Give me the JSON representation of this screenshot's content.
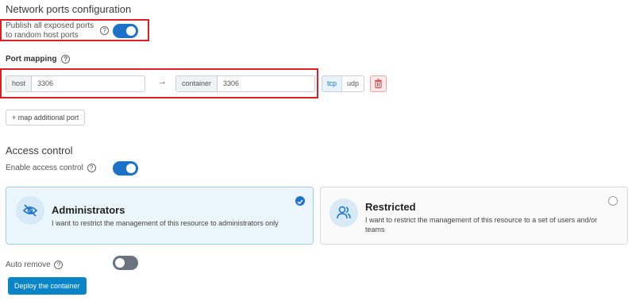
{
  "network": {
    "title": "Network ports configuration",
    "publish_label_line1": "Publish all exposed ports",
    "publish_label_line2": "to random host ports",
    "publish_enabled": true,
    "port_mapping_label": "Port mapping",
    "mapping": {
      "host_addon": "host",
      "host_value": "3306",
      "arrow": "→",
      "container_addon": "container",
      "container_value": "3306",
      "protocols": [
        "tcp",
        "udp"
      ],
      "selected_protocol": "tcp"
    },
    "add_port_label": "+ map additional port"
  },
  "access": {
    "title": "Access control",
    "enable_label": "Enable access control",
    "enabled": true,
    "options": [
      {
        "title": "Administrators",
        "description": "I want to restrict the management of this resource to administrators only",
        "selected": true,
        "icon": "eye-slash-icon"
      },
      {
        "title": "Restricted",
        "description_line1": "I want to restrict the management of this resource to a set of users and/or",
        "description_line2": "teams",
        "selected": false,
        "icon": "users-icon"
      }
    ]
  },
  "auto_remove": {
    "label": "Auto remove",
    "enabled": false
  },
  "help_glyph": "?",
  "deploy_label": "Deploy the container",
  "colors": {
    "accent": "#1a73c8",
    "primary_button": "#0a84c8",
    "highlight_box": "#e02020",
    "danger": "#e05252"
  }
}
